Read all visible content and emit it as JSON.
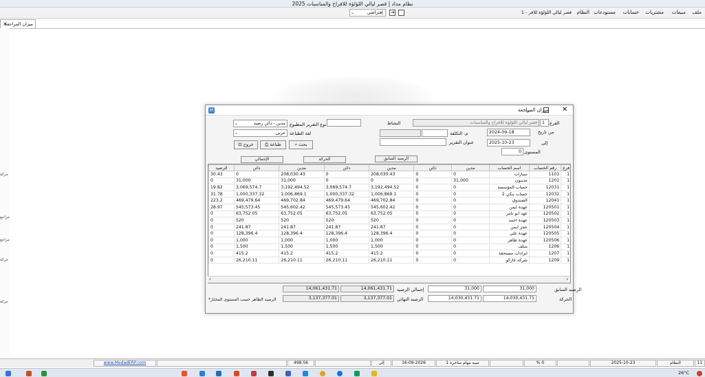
{
  "window": {
    "title": "نظام مداد | قصر ليالي اللؤلؤة للافراح والمناسبات 2025"
  },
  "menu": {
    "items": [
      "ملف",
      "مبيعات",
      "مشتريات",
      "حسابات",
      "مستودعات",
      "النظام",
      "1 - قصر ليالي اللؤلؤة للافر"
    ],
    "combo_value": "إفتراضي"
  },
  "tab": {
    "label": "ميزان المراجعة",
    "close": "×"
  },
  "side_labels": [
    "حركة",
    "مراجع",
    "مراجع",
    "حركة",
    "حركة"
  ],
  "dialog": {
    "title": "ميزان المراجعة",
    "branch_label": "الفرع",
    "branch_value": "1",
    "branch_name": "قصر ليالي اللؤلؤة للافراح والمناسبات",
    "activity_label": "النشاط",
    "report_type_label": "نوع التقرير المطبوع",
    "report_type_value": "مدين - دائن رصيد",
    "report_lang_label": "لغة الطباعة",
    "report_lang_value": "عربي",
    "from_label": "من تاريخ",
    "from_value": "2024-09-18",
    "to_label": "إلى",
    "to_value": "2025-10-23",
    "cost_label": "م. التكلفة",
    "report_title_label": "عنوان التقرير",
    "level_label": "المستوى",
    "level_value": "0",
    "search_btn": "بحث",
    "print_btn": "طباعة",
    "exit_btn": "خروج",
    "section_prev": "الرصيد السابق",
    "section_move": "الحركة",
    "section_total": "الإجمالي",
    "columns": [
      "فرع",
      "رقم الحساب",
      "اسم الحساب",
      "مدين",
      "دائن",
      "مدين",
      "دائن",
      "مدين",
      "دائن",
      "الرصيد"
    ],
    "rows": [
      {
        "branch": "1",
        "acct": "1101",
        "name": "سيارات",
        "pd": "0",
        "pc": "0",
        "md": "208,030.43",
        "mc": "0",
        "td": "208,030.43",
        "tc": "0",
        "bal": "30.43"
      },
      {
        "branch": "1",
        "acct": "1201",
        "name": "مدينون",
        "pd": "31,000",
        "pc": "0",
        "md": "0",
        "mc": "0",
        "td": "31,000",
        "tc": "31,000",
        "bal": "0"
      },
      {
        "branch": "1",
        "acct": "12031",
        "name": "حساب المؤسسة",
        "pd": "0",
        "pc": "0",
        "md": "3,192,494.52",
        "mc": "3,069,574.7",
        "td": "3,192,494.52",
        "tc": "3,069,574.7",
        "bal": "19.82"
      },
      {
        "branch": "1",
        "acct": "12032",
        "name": "حساب بنكي 2",
        "pd": "0",
        "pc": "0",
        "md": "1,006,869.1",
        "mc": "1,000,337.32",
        "td": "1,006,869.1",
        "tc": "1,000,337.32",
        "bal": "31.78"
      },
      {
        "branch": "1",
        "acct": "12041",
        "name": "الصندوق",
        "pd": "0",
        "pc": "0",
        "md": "469,702.84",
        "mc": "469,479.64",
        "td": "469,702.84",
        "tc": "469,479.64",
        "bal": "223.2"
      },
      {
        "branch": "1",
        "acct": "120501",
        "name": "عهدة ايمن",
        "pd": "0",
        "pc": "0",
        "md": "545,602.42",
        "mc": "545,573.45",
        "td": "545,602.42",
        "tc": "545,573.45",
        "bal": "28.97"
      },
      {
        "branch": "1",
        "acct": "120502",
        "name": "عهد ابو تامر",
        "pd": "0",
        "pc": "0",
        "md": "63,752.05",
        "mc": "63,752.05",
        "td": "63,752.05",
        "tc": "63,752.05",
        "bal": "0"
      },
      {
        "branch": "1",
        "acct": "120503",
        "name": "عهدة احمد",
        "pd": "0",
        "pc": "0",
        "md": "520",
        "mc": "520",
        "td": "520",
        "tc": "520",
        "bal": "0"
      },
      {
        "branch": "1",
        "acct": "120504",
        "name": "عجز ايمن",
        "pd": "0",
        "pc": "0",
        "md": "241.87",
        "mc": "241.87",
        "td": "241.87",
        "tc": "241.87",
        "bal": "0"
      },
      {
        "branch": "1",
        "acct": "120505",
        "name": "عهدة علي",
        "pd": "0",
        "pc": "0",
        "md": "128,396.4",
        "mc": "128,396.4",
        "td": "128,396.4",
        "tc": "128,396.4",
        "bal": "0"
      },
      {
        "branch": "1",
        "acct": "120506",
        "name": "عهدة طاهر",
        "pd": "0",
        "pc": "0",
        "md": "1,000",
        "mc": "1,000",
        "td": "1,000",
        "tc": "1,000",
        "bal": "0"
      },
      {
        "branch": "1",
        "acct": "1206",
        "name": "سلف",
        "pd": "0",
        "pc": "0",
        "md": "1,500",
        "mc": "1,500",
        "td": "1,500",
        "tc": "1,500",
        "bal": "0"
      },
      {
        "branch": "1",
        "acct": "1207",
        "name": "ايرادات مستحقة",
        "pd": "0",
        "pc": "0",
        "md": "415.2",
        "mc": "415.2",
        "td": "415.2",
        "tc": "415.2",
        "bal": "0"
      },
      {
        "branch": "1",
        "acct": "1209",
        "name": "شركة غازكو",
        "pd": "0",
        "pc": "0",
        "md": "26,210.11",
        "mc": "26,210.11",
        "td": "26,210.11",
        "tc": "26,210.11",
        "bal": "0"
      }
    ],
    "summary": {
      "prev_label": "الرصيد السابق",
      "prev_d": "31,000",
      "prev_c": "31,000",
      "move_label": "الحركة",
      "move_d": "14,030,431.71",
      "move_c": "14,030,431.71",
      "total_label": "إجمالي الرصيد",
      "total_d": "14,061,431.71",
      "total_c": "14,061,431.71",
      "final_label": "الرصيد النهائي",
      "final_d": "3,137,377.01",
      "final_c": "3,137,377.01",
      "note": "*الرصيد الظاهر حسب المستوى المختار"
    }
  },
  "status": {
    "cells": [
      "11",
      "النظام",
      "2025-10-23",
      "",
      "% 0",
      "",
      "تنبيه مهام متاخرة 1",
      "16-09-2026",
      "إلى",
      "",
      "498.56",
      "",
      "www.MedadERP.com"
    ]
  },
  "taskbar": {
    "temp": "26°C"
  }
}
